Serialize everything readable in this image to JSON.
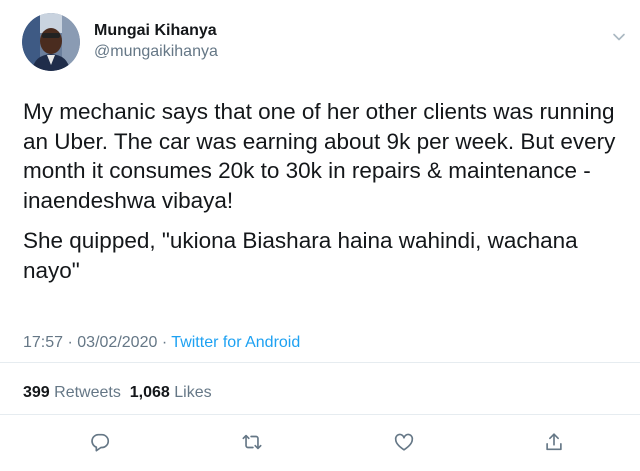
{
  "author": {
    "display_name": "Mungai Kihanya",
    "handle": "@mungaikihanya",
    "avatar_icon": "profile-photo"
  },
  "tweet": {
    "paragraphs": [
      "My mechanic says that one of her other clients was running an Uber. The car was earning about 9k per week. But every month it consumes 20k to 30k in repairs & maintenance - inaendeshwa vibaya!",
      "She quipped, \"ukiona Biashara haina wahindi, wachana nayo\""
    ]
  },
  "meta": {
    "time": "17:57",
    "separator": "·",
    "date": "03/02/2020",
    "source": "Twitter for Android"
  },
  "stats": {
    "retweets_count": "1,068",
    "retweets_count_value": "399",
    "retweets_label": "Retweets",
    "likes_count": "1,068",
    "likes_label": "Likes"
  },
  "actions": {
    "reply_icon": "reply-icon",
    "retweet_icon": "retweet-icon",
    "like_icon": "heart-icon",
    "share_icon": "share-icon"
  },
  "colors": {
    "text": "#14171a",
    "secondary": "#657786",
    "link": "#1da1f2",
    "divider": "#e6ecf0"
  }
}
